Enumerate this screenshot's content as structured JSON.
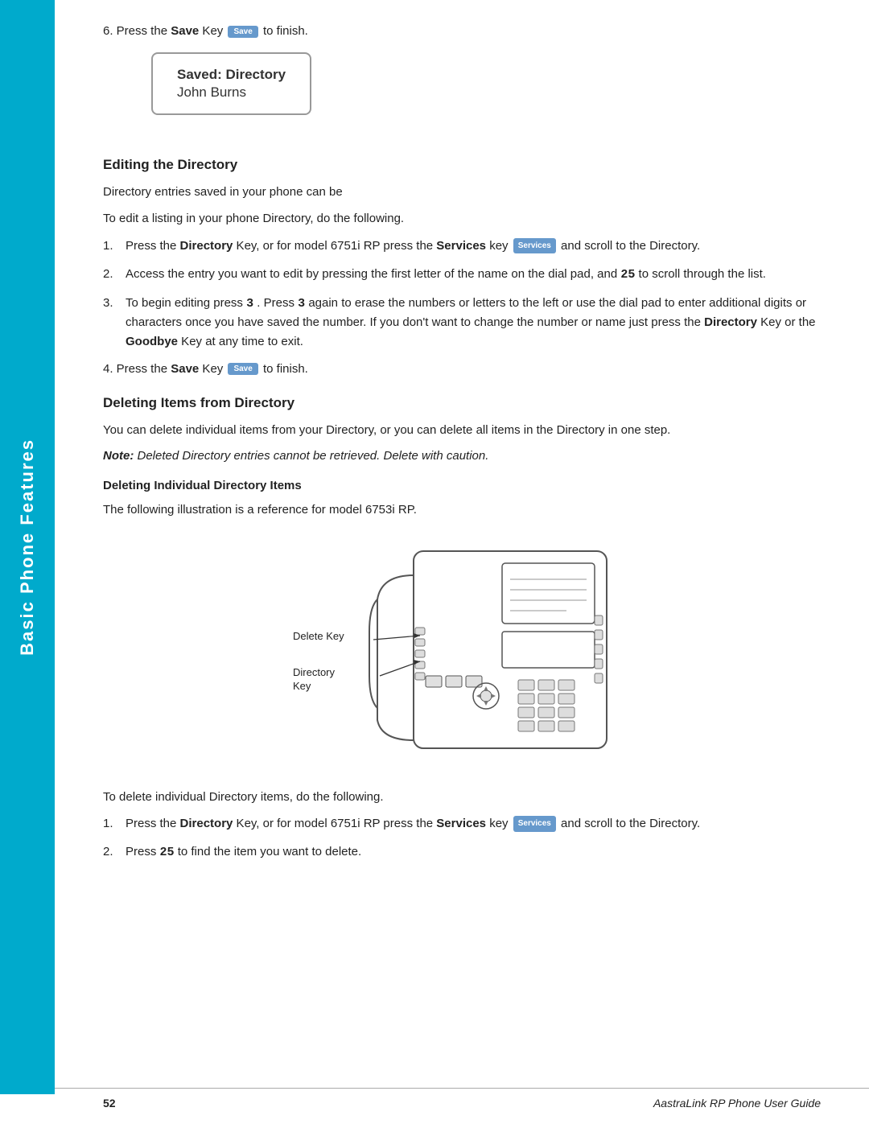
{
  "sidebar": {
    "label": "Basic Phone Features"
  },
  "step6": {
    "text_before": "6.  Press the ",
    "bold_word": "Save",
    "text_middle": " Key",
    "save_btn_label": "Save",
    "text_after": " to finish."
  },
  "saved_box": {
    "line1": "Saved: Directory",
    "line2": "John Burns"
  },
  "editing_section": {
    "heading": "Editing the Directory",
    "para1": "Directory entries saved in your phone can be",
    "para2": "To edit a listing in your phone Directory, do the following.",
    "items": [
      {
        "num": "1.",
        "text_before": "Press the ",
        "bold1": "Directory",
        "text_mid1": " Key, or for model 6751i RP press the ",
        "bold2": "Services",
        "text_mid2": " key",
        "services_btn": "Services",
        "text_after": " and scroll to the Directory."
      },
      {
        "num": "2.",
        "text": "Access the entry you want to edit by pressing the first letter of the name on the dial pad, and",
        "mono": "25",
        "text2": "to scroll through the list."
      },
      {
        "num": "3.",
        "text_before": "To begin editing press",
        "mono1": "3",
        "text_mid": ". Press",
        "mono2": "3",
        "text_after": "again to erase the numbers or letters to the left or use the dial pad to enter additional digits or characters once you have saved the number. If you don't want to change the number or name just press the",
        "bold1": "Directory",
        "text_end1": "Key or the",
        "bold2": "Goodbye",
        "text_end2": "Key at any time to exit."
      }
    ],
    "item4_before": "4.  Press the ",
    "item4_bold": "Save",
    "item4_mid": " Key",
    "item4_save_btn": "Save",
    "item4_after": " to finish."
  },
  "deleting_section": {
    "heading": "Deleting Items from Directory",
    "para1": "You can delete individual items from your Directory, or you can delete all items in the Directory in one step.",
    "note": "Note: Deleted Directory entries cannot be retrieved. Delete with caution.",
    "subsection_heading": "Deleting Individual Directory Items",
    "illustration_caption": "The following illustration is a reference for model 6753i RP.",
    "label_delete": "Delete Key",
    "label_directory": "Directory Key",
    "para_after": "To delete individual Directory items, do the following.",
    "items": [
      {
        "num": "1.",
        "text_before": "Press the ",
        "bold1": "Directory",
        "text_mid1": " Key, or for model 6751i RP press the ",
        "bold2": "Services",
        "text_mid2": " key",
        "services_btn": "Services",
        "text_after": " and scroll to the Directory."
      },
      {
        "num": "2.",
        "text_before": "Press",
        "mono": "25",
        "text_after": "to find the item you want to delete."
      }
    ]
  },
  "footer": {
    "page_number": "52",
    "title": "AastraLink RP Phone User Guide"
  }
}
